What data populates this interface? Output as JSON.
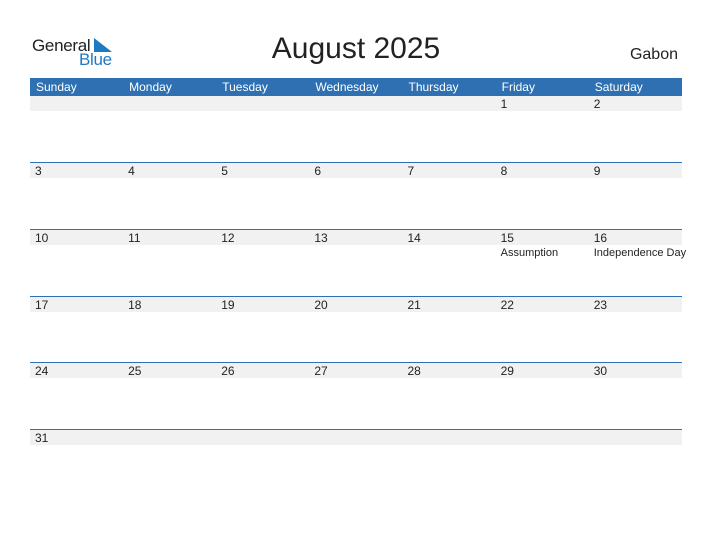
{
  "logo": {
    "general": "General",
    "blue": "Blue"
  },
  "title": "August 2025",
  "country": "Gabon",
  "weekdays": [
    "Sunday",
    "Monday",
    "Tuesday",
    "Wednesday",
    "Thursday",
    "Friday",
    "Saturday"
  ],
  "weeks": [
    [
      {
        "d": ""
      },
      {
        "d": ""
      },
      {
        "d": ""
      },
      {
        "d": ""
      },
      {
        "d": ""
      },
      {
        "d": "1"
      },
      {
        "d": "2"
      }
    ],
    [
      {
        "d": "3"
      },
      {
        "d": "4"
      },
      {
        "d": "5"
      },
      {
        "d": "6"
      },
      {
        "d": "7"
      },
      {
        "d": "8"
      },
      {
        "d": "9"
      }
    ],
    [
      {
        "d": "10"
      },
      {
        "d": "11"
      },
      {
        "d": "12"
      },
      {
        "d": "13"
      },
      {
        "d": "14"
      },
      {
        "d": "15",
        "h": "Assumption"
      },
      {
        "d": "16",
        "h": "Independence Day"
      }
    ],
    [
      {
        "d": "17"
      },
      {
        "d": "18"
      },
      {
        "d": "19"
      },
      {
        "d": "20"
      },
      {
        "d": "21"
      },
      {
        "d": "22"
      },
      {
        "d": "23"
      }
    ],
    [
      {
        "d": "24"
      },
      {
        "d": "25"
      },
      {
        "d": "26"
      },
      {
        "d": "27"
      },
      {
        "d": "28"
      },
      {
        "d": "29"
      },
      {
        "d": "30"
      }
    ],
    [
      {
        "d": "31"
      },
      {
        "d": ""
      },
      {
        "d": ""
      },
      {
        "d": ""
      },
      {
        "d": ""
      },
      {
        "d": ""
      },
      {
        "d": ""
      }
    ]
  ],
  "colors": {
    "header": "#2e70b1",
    "brand_blue": "#1f7ac4",
    "day_band": "#f1f1f1"
  }
}
